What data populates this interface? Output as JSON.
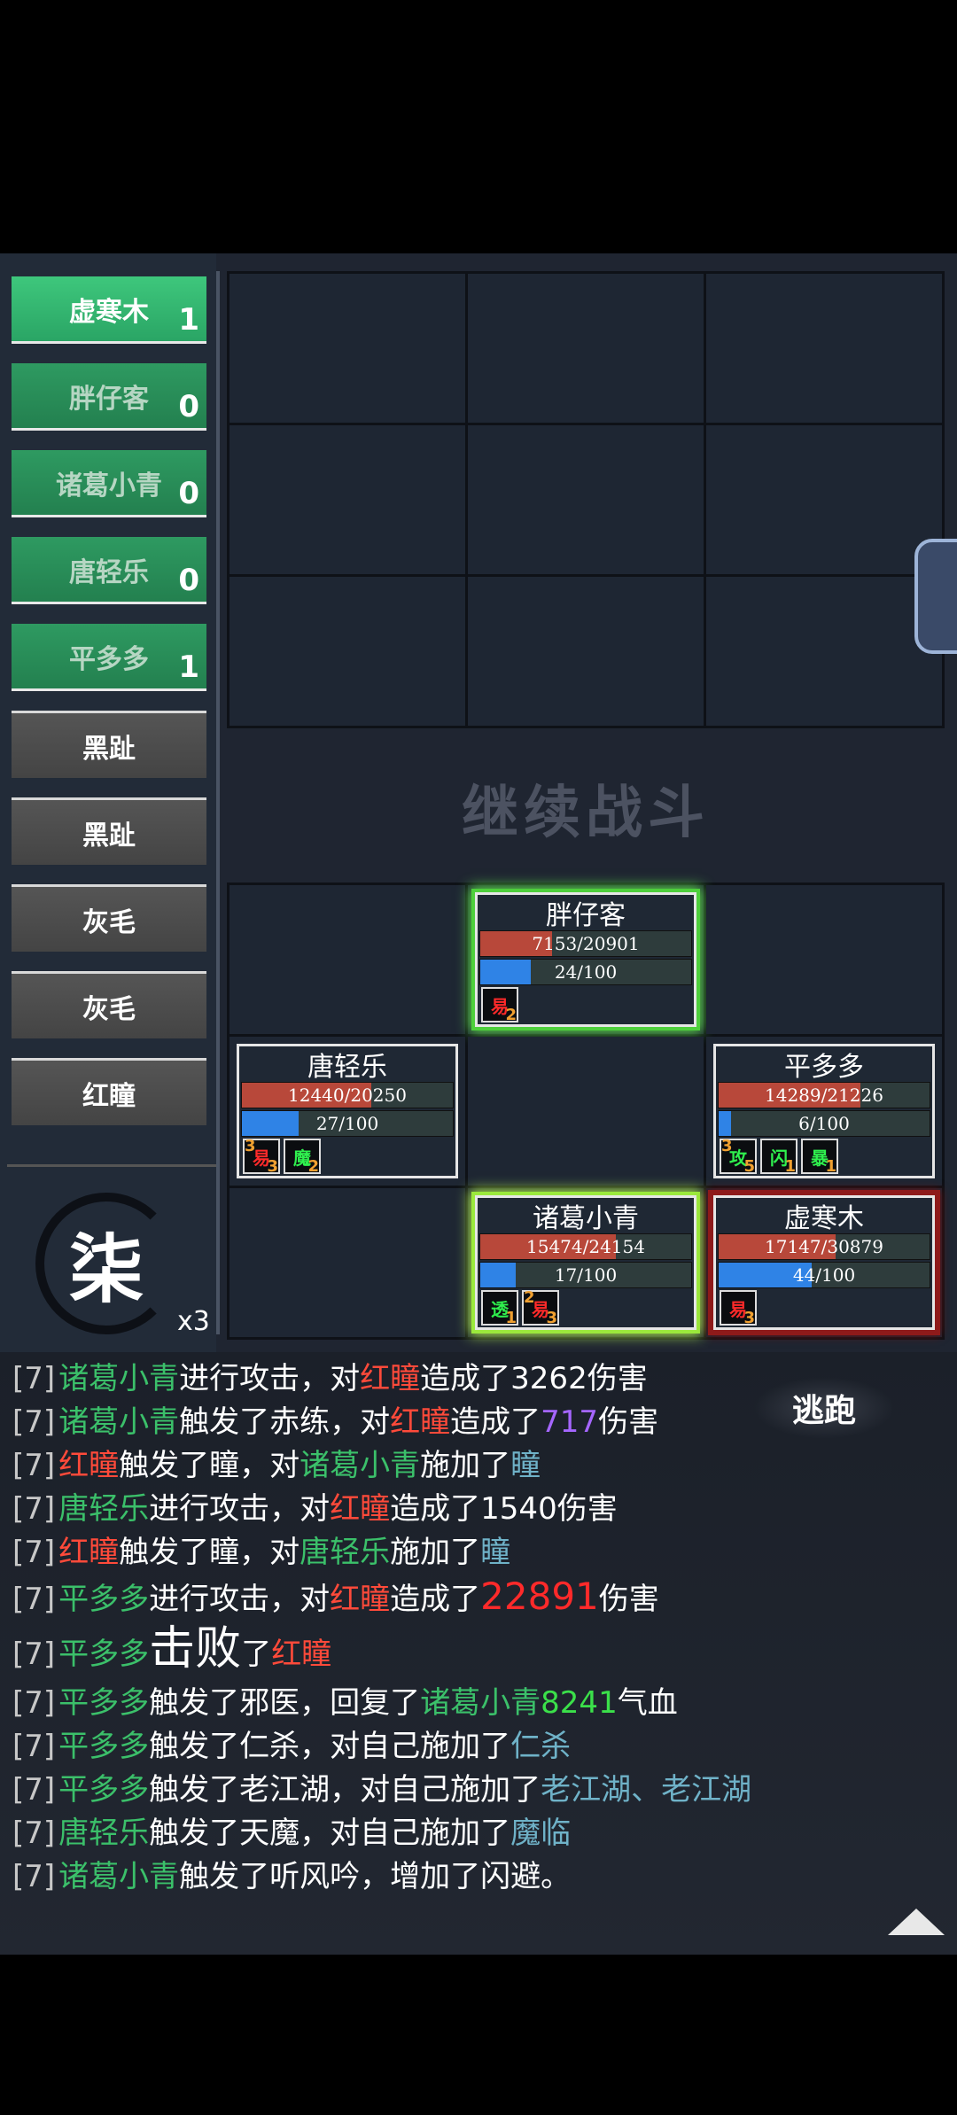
{
  "colors": {
    "ally_name": "#3bc06a",
    "enemy_name": "#ff4a3a",
    "skill_name": "#6fb2c8",
    "hp_bar": "#b8483a",
    "mp_bar": "#2f83e6"
  },
  "side_list": {
    "allies": [
      {
        "name": "虚寒木",
        "count": "1",
        "active": true
      },
      {
        "name": "胖仔客",
        "count": "0"
      },
      {
        "name": "诸葛小青",
        "count": "0"
      },
      {
        "name": "唐轻乐",
        "count": "0"
      },
      {
        "name": "平多多",
        "count": "1"
      }
    ],
    "enemies": [
      {
        "name": "黑趾"
      },
      {
        "name": "黑趾"
      },
      {
        "name": "灰毛"
      },
      {
        "name": "灰毛"
      },
      {
        "name": "红瞳"
      }
    ]
  },
  "round": {
    "number": "柒",
    "speed": "x3"
  },
  "battlefield": {
    "continue_label": "继续战斗"
  },
  "units": {
    "pangzaike": {
      "name": "胖仔客",
      "hp": "7153/20901",
      "hp_ratio": 0.342,
      "mp": "24/100",
      "mp_ratio": 0.24,
      "buffs": [
        {
          "char": "易",
          "count": "2",
          "color": "red"
        }
      ]
    },
    "tangqingle": {
      "name": "唐轻乐",
      "hp": "12440/20250",
      "hp_ratio": 0.614,
      "mp": "27/100",
      "mp_ratio": 0.27,
      "buffs": [
        {
          "char": "易",
          "count": "3",
          "pre": "3",
          "color": "red"
        },
        {
          "char": "魔",
          "count": "2",
          "color": "grn"
        }
      ]
    },
    "pingduoduo": {
      "name": "平多多",
      "hp": "14289/21226",
      "hp_ratio": 0.673,
      "mp": "6/100",
      "mp_ratio": 0.06,
      "buffs": [
        {
          "char": "攻",
          "count": "5",
          "pre": "3",
          "color": "grn"
        },
        {
          "char": "闪",
          "count": "1",
          "color": "grn"
        },
        {
          "char": "暴",
          "count": "1",
          "color": "grn"
        }
      ]
    },
    "zhugexiaoqing": {
      "name": "诸葛小青",
      "hp": "15474/24154",
      "hp_ratio": 0.641,
      "mp": "17/100",
      "mp_ratio": 0.17,
      "buffs": [
        {
          "char": "透",
          "count": "1",
          "color": "grn"
        },
        {
          "char": "易",
          "count": "3",
          "pre": "2",
          "color": "red"
        }
      ]
    },
    "xuhanmu": {
      "name": "虚寒木",
      "hp": "17147/30879",
      "hp_ratio": 0.555,
      "mp": "44/100",
      "mp_ratio": 0.44,
      "buffs": [
        {
          "char": "易",
          "count": "3",
          "color": "red"
        }
      ]
    }
  },
  "escape_label": "逃跑",
  "log": [
    {
      "prefix": "[7]",
      "parts": [
        [
          "a",
          "诸葛小青"
        ],
        [
          "t",
          "进行攻击，对"
        ],
        [
          "e",
          "红瞳"
        ],
        [
          "t",
          "造成了3262伤害"
        ]
      ]
    },
    {
      "prefix": "[7]",
      "parts": [
        [
          "a",
          "诸葛小青"
        ],
        [
          "t",
          "触发了赤练，对"
        ],
        [
          "e",
          "红瞳"
        ],
        [
          "t",
          "造成了"
        ],
        [
          "p",
          "717"
        ],
        [
          "t",
          "伤害"
        ]
      ]
    },
    {
      "prefix": "[7]",
      "parts": [
        [
          "e",
          "红瞳"
        ],
        [
          "t",
          "触发了瞳，对"
        ],
        [
          "a",
          "诸葛小青"
        ],
        [
          "t",
          "施加了"
        ],
        [
          "s",
          "瞳"
        ]
      ]
    },
    {
      "prefix": "[7]",
      "parts": [
        [
          "a",
          "唐轻乐"
        ],
        [
          "t",
          "进行攻击，对"
        ],
        [
          "e",
          "红瞳"
        ],
        [
          "t",
          "造成了1540伤害"
        ]
      ]
    },
    {
      "prefix": "[7]",
      "parts": [
        [
          "e",
          "红瞳"
        ],
        [
          "t",
          "触发了瞳，对"
        ],
        [
          "a",
          "唐轻乐"
        ],
        [
          "t",
          "施加了"
        ],
        [
          "s",
          "瞳"
        ]
      ]
    },
    {
      "prefix": "[7]",
      "parts": [
        [
          "a",
          "平多多"
        ],
        [
          "t",
          "进行攻击，对"
        ],
        [
          "e",
          "红瞳"
        ],
        [
          "t",
          "造成了"
        ],
        [
          "br",
          "22891"
        ],
        [
          "t",
          "伤害"
        ]
      ]
    },
    {
      "prefix": "[7]",
      "tall": true,
      "parts": [
        [
          "a",
          "平多多"
        ],
        [
          "big",
          "击败"
        ],
        [
          "t",
          "了"
        ],
        [
          "e",
          "红瞳"
        ]
      ]
    },
    {
      "prefix": "[7]",
      "parts": [
        [
          "a",
          "平多多"
        ],
        [
          "t",
          "触发了邪医，回复了"
        ],
        [
          "a",
          "诸葛小青"
        ],
        [
          "g",
          "8241"
        ],
        [
          "t",
          "气血"
        ]
      ]
    },
    {
      "prefix": "[7]",
      "parts": [
        [
          "a",
          "平多多"
        ],
        [
          "t",
          "触发了仁杀，对自己施加了"
        ],
        [
          "s",
          "仁杀"
        ]
      ]
    },
    {
      "prefix": "[7]",
      "parts": [
        [
          "a",
          "平多多"
        ],
        [
          "t",
          "触发了老江湖，对自己施加了"
        ],
        [
          "s",
          "老江湖、老江湖"
        ]
      ]
    },
    {
      "prefix": "[7]",
      "parts": [
        [
          "a",
          "唐轻乐"
        ],
        [
          "t",
          "触发了天魔，对自己施加了"
        ],
        [
          "s",
          "魔临"
        ]
      ]
    },
    {
      "prefix": "[7]",
      "parts": [
        [
          "a",
          "诸葛小青"
        ],
        [
          "t",
          "触发了听风吟，增加了闪避。"
        ]
      ]
    }
  ]
}
